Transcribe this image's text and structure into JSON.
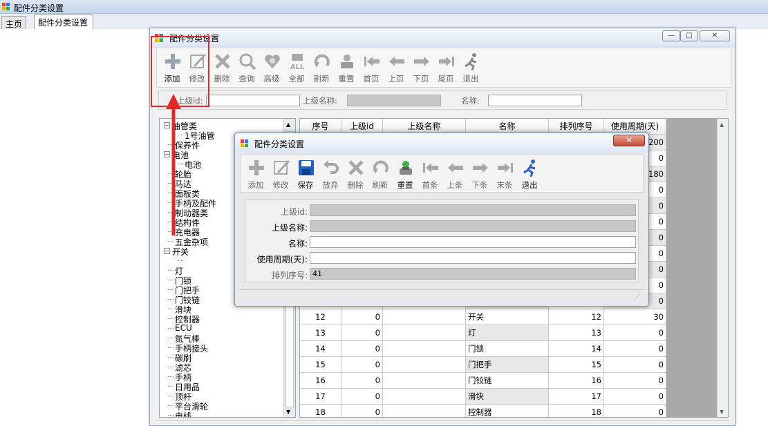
{
  "window_title": "配件分类设置",
  "tabs": [
    "主页",
    "配件分类设置"
  ],
  "mdi": {
    "title": "配件分类设置",
    "win_buttons": {
      "min": "—",
      "max": "□",
      "close": "✕"
    },
    "toolbar": [
      {
        "label": "添加",
        "icon": "plus-icon",
        "enabled": true
      },
      {
        "label": "修改",
        "icon": "edit-icon",
        "enabled": false
      },
      {
        "label": "删除",
        "icon": "delete-x-icon",
        "enabled": false
      },
      {
        "label": "查询",
        "icon": "magnifier-icon",
        "enabled": false
      },
      {
        "label": "高级",
        "icon": "heart-search-icon",
        "enabled": false
      },
      {
        "label": "全部",
        "icon": "all-icon",
        "enabled": false
      },
      {
        "label": "刷新",
        "icon": "refresh-icon",
        "enabled": false
      },
      {
        "label": "重置",
        "icon": "reset-icon",
        "enabled": false
      },
      {
        "label": "首页",
        "icon": "first-page-icon",
        "enabled": false
      },
      {
        "label": "上页",
        "icon": "prev-page-icon",
        "enabled": false
      },
      {
        "label": "下页",
        "icon": "next-page-icon",
        "enabled": false
      },
      {
        "label": "尾页",
        "icon": "last-page-icon",
        "enabled": false
      },
      {
        "label": "退出",
        "icon": "exit-runner-icon",
        "enabled": false
      }
    ],
    "filter": {
      "parent_id_label": "上级id:",
      "parent_name_label": "上级名称:",
      "name_label": "名称:"
    },
    "tree": [
      {
        "text": "油管类",
        "level": 0,
        "box": "⊟"
      },
      {
        "text": "1号油管",
        "level": 2,
        "box": ""
      },
      {
        "text": "保养件",
        "level": 1,
        "box": ""
      },
      {
        "text": "电池",
        "level": 0,
        "box": "⊟"
      },
      {
        "text": "电池",
        "level": 2,
        "box": ""
      },
      {
        "text": "轮胎",
        "level": 1,
        "box": ""
      },
      {
        "text": "马达",
        "level": 1,
        "box": ""
      },
      {
        "text": "面板类",
        "level": 1,
        "box": ""
      },
      {
        "text": "手柄及配件",
        "level": 1,
        "box": ""
      },
      {
        "text": "制动器类",
        "level": 1,
        "box": ""
      },
      {
        "text": "结构件",
        "level": 1,
        "box": ""
      },
      {
        "text": "充电器",
        "level": 1,
        "box": ""
      },
      {
        "text": "五金杂项",
        "level": 1,
        "box": ""
      },
      {
        "text": "开关",
        "level": 0,
        "box": "⊟"
      },
      {
        "text": "",
        "level": 2,
        "box": ""
      },
      {
        "text": "灯",
        "level": 1,
        "box": ""
      },
      {
        "text": "门锁",
        "level": 1,
        "box": ""
      },
      {
        "text": "门把手",
        "level": 1,
        "box": ""
      },
      {
        "text": "门铰链",
        "level": 1,
        "box": ""
      },
      {
        "text": "滑块",
        "level": 1,
        "box": ""
      },
      {
        "text": "控制器",
        "level": 1,
        "box": ""
      },
      {
        "text": "ECU",
        "level": 1,
        "box": ""
      },
      {
        "text": "氮气棒",
        "level": 1,
        "box": ""
      },
      {
        "text": "手柄接头",
        "level": 1,
        "box": ""
      },
      {
        "text": "碳刷",
        "level": 1,
        "box": ""
      },
      {
        "text": "滤芯",
        "level": 1,
        "box": ""
      },
      {
        "text": "手柄",
        "level": 1,
        "box": ""
      },
      {
        "text": "日用品",
        "level": 1,
        "box": ""
      },
      {
        "text": "顶杆",
        "level": 1,
        "box": ""
      },
      {
        "text": "平台滑轮",
        "level": 1,
        "box": ""
      },
      {
        "text": "电线",
        "level": 1,
        "box": ""
      }
    ],
    "grid": {
      "headers": [
        "序号",
        "上级id",
        "上级名称",
        "名称",
        "排列序号",
        "使用周期(天)"
      ],
      "top_periods": [
        "200",
        "0",
        "180",
        "0",
        "0",
        "0",
        "0",
        "0",
        "0",
        "0",
        "0"
      ],
      "rows": [
        [
          "12",
          "0",
          "",
          "开关",
          "12",
          "30"
        ],
        [
          "13",
          "0",
          "",
          "灯",
          "13",
          "0"
        ],
        [
          "14",
          "0",
          "",
          "门锁",
          "14",
          "0"
        ],
        [
          "15",
          "0",
          "",
          "门把手",
          "15",
          "0"
        ],
        [
          "16",
          "0",
          "",
          "门铰链",
          "16",
          "0"
        ],
        [
          "17",
          "0",
          "",
          "滑块",
          "17",
          "0"
        ],
        [
          "18",
          "0",
          "",
          "控制器",
          "18",
          "0"
        ]
      ]
    }
  },
  "dialog": {
    "title": "配件分类设置",
    "close": "✕",
    "toolbar": [
      {
        "label": "添加",
        "icon": "plus-icon",
        "enabled": false
      },
      {
        "label": "修改",
        "icon": "edit-icon",
        "enabled": false
      },
      {
        "label": "保存",
        "icon": "save-disk-icon",
        "enabled": true
      },
      {
        "label": "放弃",
        "icon": "undo-icon",
        "enabled": false
      },
      {
        "label": "删除",
        "icon": "delete-x-icon",
        "enabled": false
      },
      {
        "label": "刷新",
        "icon": "refresh-icon",
        "enabled": false
      },
      {
        "label": "重置",
        "icon": "reset-icon",
        "enabled": true
      },
      {
        "label": "首条",
        "icon": "first-record-icon",
        "enabled": false
      },
      {
        "label": "上条",
        "icon": "prev-record-icon",
        "enabled": false
      },
      {
        "label": "下条",
        "icon": "next-record-icon",
        "enabled": false
      },
      {
        "label": "末条",
        "icon": "last-record-icon",
        "enabled": false
      },
      {
        "label": "退出",
        "icon": "exit-runner-icon",
        "enabled": true
      }
    ],
    "form": [
      {
        "label": "上级id:",
        "value": "",
        "readonly": true,
        "disabled_label": true
      },
      {
        "label": "上级名称:",
        "value": "",
        "readonly": true,
        "disabled_label": false
      },
      {
        "label": "名称:",
        "value": "",
        "readonly": false,
        "disabled_label": false
      },
      {
        "label": "使用周期(天):",
        "value": "",
        "readonly": false,
        "disabled_label": false
      },
      {
        "label": "排列序号:",
        "value": "41",
        "readonly": true,
        "disabled_label": true
      }
    ]
  },
  "colors": {
    "annotation_red": "#e02a2a",
    "save_blue": "#1f5fbf",
    "exit_blue": "#2a5fd8"
  }
}
